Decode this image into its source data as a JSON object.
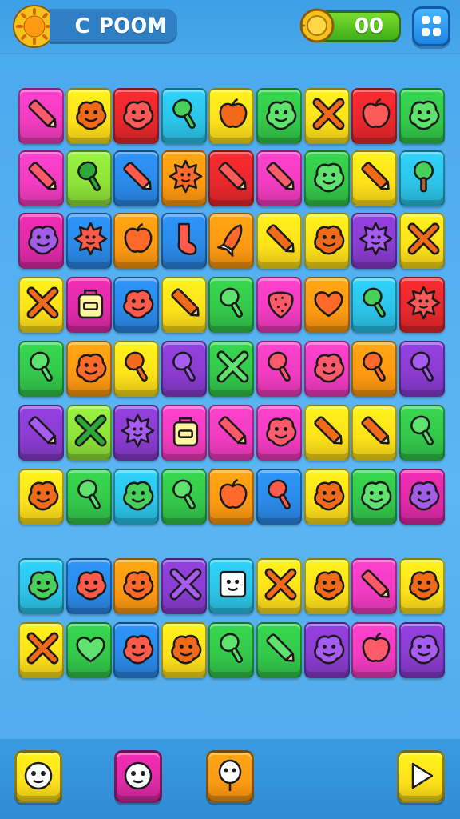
{
  "header": {
    "player_initial": "C",
    "player_name": "POOM",
    "score": "00",
    "icons": {
      "badge": "sun-badge-icon",
      "coin": "coin-icon",
      "menu": "dice-menu-icon"
    }
  },
  "colors": {
    "pink": "#f23cc0",
    "yellow": "#ffe11a",
    "red": "#e8282c",
    "cyan": "#2cc4e8",
    "green": "#34c84a",
    "blue": "#2b8ae8",
    "orange": "#ff9a12",
    "purple": "#8a3cd0",
    "lime": "#8ee23a",
    "magenta": "#e02aa8"
  },
  "board": {
    "rows": [
      [
        [
          "pink",
          "pencil"
        ],
        [
          "yellow",
          "blob"
        ],
        [
          "red",
          "blob"
        ],
        [
          "cyan",
          "bottle"
        ],
        [
          "yellow",
          "apple"
        ],
        [
          "green",
          "blob"
        ],
        [
          "yellow",
          "cross"
        ],
        [
          "red",
          "apple"
        ],
        [
          "green",
          "blob"
        ]
      ],
      [
        [
          "pink",
          "pencil"
        ],
        [
          "lime",
          "bottle"
        ],
        [
          "blue",
          "pencil"
        ],
        [
          "orange",
          "sun"
        ],
        [
          "red",
          "pencil"
        ],
        [
          "pink",
          "pencil"
        ],
        [
          "green",
          "blob"
        ],
        [
          "yellow",
          "pencil"
        ],
        [
          "cyan",
          "tree"
        ]
      ],
      [
        [
          "magenta",
          "blob"
        ],
        [
          "blue",
          "sun"
        ],
        [
          "orange",
          "apple"
        ],
        [
          "blue",
          "sock"
        ],
        [
          "orange",
          "rocket"
        ],
        [
          "yellow",
          "pencil"
        ],
        [
          "yellow",
          "blob"
        ],
        [
          "purple",
          "sun"
        ],
        [
          "yellow",
          "cross"
        ]
      ],
      [
        [
          "yellow",
          "cross"
        ],
        [
          "magenta",
          "bag"
        ],
        [
          "blue",
          "blob"
        ],
        [
          "yellow",
          "pencil"
        ],
        [
          "green",
          "bottle"
        ],
        [
          "pink",
          "strawberry"
        ],
        [
          "orange",
          "heart"
        ],
        [
          "cyan",
          "bottle"
        ],
        [
          "red",
          "sun"
        ]
      ],
      [
        [
          "green",
          "bottle"
        ],
        [
          "orange",
          "blob"
        ],
        [
          "yellow",
          "bottle"
        ],
        [
          "purple",
          "bottle"
        ],
        [
          "green",
          "cross"
        ],
        [
          "pink",
          "bottle"
        ],
        [
          "pink",
          "blob"
        ],
        [
          "orange",
          "bottle"
        ],
        [
          "purple",
          "bottle"
        ]
      ],
      [
        [
          "purple",
          "pencil"
        ],
        [
          "lime",
          "cross"
        ],
        [
          "purple",
          "sun"
        ],
        [
          "pink",
          "bag"
        ],
        [
          "pink",
          "pencil"
        ],
        [
          "pink",
          "blob"
        ],
        [
          "yellow",
          "pencil"
        ],
        [
          "yellow",
          "pencil"
        ],
        [
          "green",
          "bottle"
        ]
      ],
      [
        [
          "yellow",
          "blob"
        ],
        [
          "green",
          "bottle"
        ],
        [
          "cyan",
          "blob"
        ],
        [
          "green",
          "bottle"
        ],
        [
          "orange",
          "apple"
        ],
        [
          "blue",
          "bottle"
        ],
        [
          "yellow",
          "blob"
        ],
        [
          "green",
          "blob"
        ],
        [
          "magenta",
          "blob"
        ]
      ]
    ],
    "tray": [
      [
        [
          "cyan",
          "blob"
        ],
        [
          "blue",
          "blob"
        ],
        [
          "orange",
          "blob"
        ],
        [
          "purple",
          "cross"
        ],
        [
          "cyan",
          "box"
        ],
        [
          "yellow",
          "cross"
        ],
        [
          "yellow",
          "blob"
        ],
        [
          "pink",
          "pencil"
        ],
        [
          "yellow",
          "blob"
        ]
      ],
      [
        [
          "yellow",
          "cross"
        ],
        [
          "green",
          "heart"
        ],
        [
          "blue",
          "blob"
        ],
        [
          "yellow",
          "blob"
        ],
        [
          "green",
          "bottle"
        ],
        [
          "green",
          "pencil"
        ],
        [
          "purple",
          "blob"
        ],
        [
          "pink",
          "apple"
        ],
        [
          "purple",
          "blob"
        ]
      ]
    ]
  },
  "footer": {
    "buttons": [
      {
        "name": "hint-button",
        "color": "yellow",
        "icon": "face-icon"
      },
      {
        "name": "shuffle-button",
        "color": "magenta",
        "icon": "face-icon"
      },
      {
        "name": "undo-button",
        "color": "orange",
        "icon": "balloon-face-icon"
      },
      {
        "name": "play-button",
        "color": "yellow",
        "icon": "play-icon"
      }
    ]
  }
}
